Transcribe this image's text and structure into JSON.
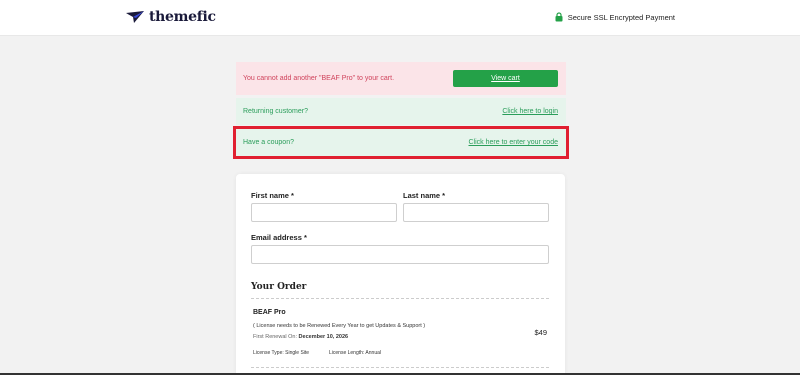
{
  "header": {
    "brand": "themefic",
    "ssl_text": "Secure SSL Encrypted Payment",
    "colors": {
      "brand_navy": "#1a1a3a",
      "lock_green": "#24a148"
    }
  },
  "notices": {
    "error_text": "You cannot add another \"BEAF Pro\" to your cart.",
    "view_cart_label": "View cart",
    "returning_text": "Returning customer?",
    "login_link": "Click here to login",
    "coupon_text": "Have a coupon?",
    "coupon_link": "Click here to enter your code"
  },
  "form": {
    "first_name_label": "First name *",
    "last_name_label": "Last name *",
    "email_label": "Email address *",
    "first_name_value": "",
    "last_name_value": "",
    "email_value": ""
  },
  "order": {
    "title": "Your Order",
    "product_name": "BEAF Pro",
    "note": "( License needs to be Renewed Every Year to get Updates & Support )",
    "renewal_label": "First Renewal On:",
    "renewal_date": "December 10, 2026",
    "price": "$49",
    "license_type": "License Type: Single Site",
    "license_length": "License Length: Annual"
  },
  "colors": {
    "error_bg": "#fbe4e8",
    "error_text": "#d0435c",
    "success_bg": "#e6f4ec",
    "success_text": "#2a9d5a",
    "button_green": "#24a148",
    "highlight_red": "#e02030"
  }
}
